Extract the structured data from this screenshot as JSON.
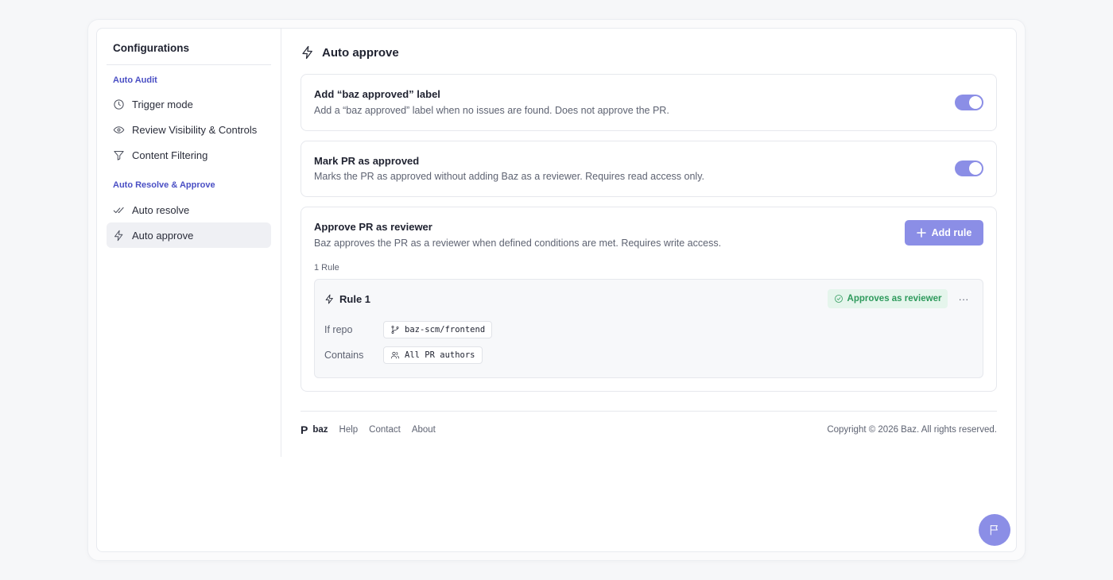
{
  "sidebar": {
    "title": "Configurations",
    "sections": [
      {
        "label": "Auto Audit",
        "items": [
          {
            "label": "Trigger mode",
            "icon": "clock-icon"
          },
          {
            "label": "Review Visibility & Controls",
            "icon": "eye-icon"
          },
          {
            "label": "Content Filtering",
            "icon": "filter-icon"
          }
        ]
      },
      {
        "label": "Auto Resolve & Approve",
        "items": [
          {
            "label": "Auto resolve",
            "icon": "double-check-icon"
          },
          {
            "label": "Auto approve",
            "icon": "lightning-icon",
            "active": true
          }
        ]
      }
    ]
  },
  "main": {
    "title": "Auto approve",
    "cards": [
      {
        "title": "Add “baz approved” label",
        "description": "Add a “baz approved” label when no issues are found. Does not approve the PR.",
        "toggle_on": true
      },
      {
        "title": "Mark PR as approved",
        "description": "Marks the PR as approved without adding Baz as a reviewer. Requires read access only.",
        "toggle_on": true
      }
    ],
    "reviewer_card": {
      "title": "Approve PR as reviewer",
      "description": "Baz approves the PR as a reviewer when defined conditions are met. Requires write access.",
      "add_rule_label": "Add rule",
      "rule_count": "1 Rule",
      "rules": [
        {
          "name": "Rule 1",
          "badge": "Approves as reviewer",
          "more": "···",
          "conditions": [
            {
              "label": "If repo",
              "value": "baz-scm/frontend",
              "icon": "git-branch-icon"
            },
            {
              "label": "Contains",
              "value": "All PR authors",
              "icon": "users-icon"
            }
          ]
        }
      ]
    }
  },
  "footer": {
    "logo_mark": "P",
    "logo_text": "baz",
    "links": [
      "Help",
      "Contact",
      "About"
    ],
    "copyright": "Copyright © 2026 Baz. All rights reserved."
  },
  "colors": {
    "accent": "#8b8ee6",
    "section_label": "#4a4fc4",
    "badge_bg": "#e5f5ec",
    "badge_text": "#2e9a5c"
  }
}
